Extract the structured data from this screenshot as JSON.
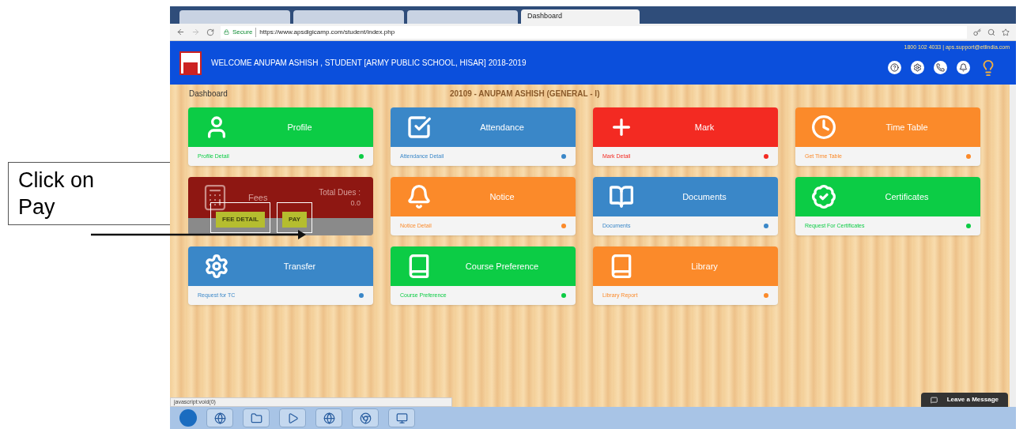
{
  "callout": {
    "text": "Click on Pay"
  },
  "browser": {
    "tabs": [
      {
        "label": "Dashboard",
        "selected": true
      }
    ],
    "secure_label": "Secure",
    "url": "https://www.apsdigicamp.com/student/index.php"
  },
  "header": {
    "contact": "1800 102 4033 | aps.support@etlindia.com",
    "welcome": "WELCOME ANUPAM ASHISH , STUDENT [ARMY PUBLIC SCHOOL, HISAR] 2018-2019"
  },
  "breadcrumb": "Dashboard",
  "student_title": "20109 - ANUPAM ASHISH (GENERAL - I)",
  "cards": [
    {
      "kind": "standard",
      "title": "Profile",
      "footer": "Profile Detail",
      "color": "#0ccc45"
    },
    {
      "kind": "standard",
      "title": "Attendance",
      "footer": "Attendance Detail",
      "color": "#3a87c8"
    },
    {
      "kind": "standard",
      "title": "Mark",
      "footer": "Mark Detail",
      "color": "#f32a22"
    },
    {
      "kind": "standard",
      "title": "Time Table",
      "footer": "Get Time Table",
      "color": "#fb8a2a"
    },
    {
      "kind": "fees",
      "title": "Fees",
      "dues_label": "Total Dues :",
      "dues": "0.0",
      "buttons": [
        "FEE DETAIL",
        "PAY"
      ],
      "color": "#8e1712"
    },
    {
      "kind": "standard",
      "title": "Notice",
      "footer": "Notice Detail",
      "color": "#fb8a2a"
    },
    {
      "kind": "standard",
      "title": "Documents",
      "footer": "Documents",
      "color": "#3a87c8"
    },
    {
      "kind": "standard",
      "title": "Certificates",
      "footer": "Request For Certificates",
      "color": "#0ccc45"
    },
    {
      "kind": "standard",
      "title": "Transfer",
      "footer": "Request for TC",
      "color": "#3a87c8"
    },
    {
      "kind": "standard",
      "title": "Course Preference",
      "footer": "Course Preference",
      "color": "#0ccc45"
    },
    {
      "kind": "standard",
      "title": "Library",
      "footer": "Library Report",
      "color": "#fb8a2a"
    }
  ],
  "status_text": "javascript:void(0)",
  "chat_button": "Leave a Message"
}
